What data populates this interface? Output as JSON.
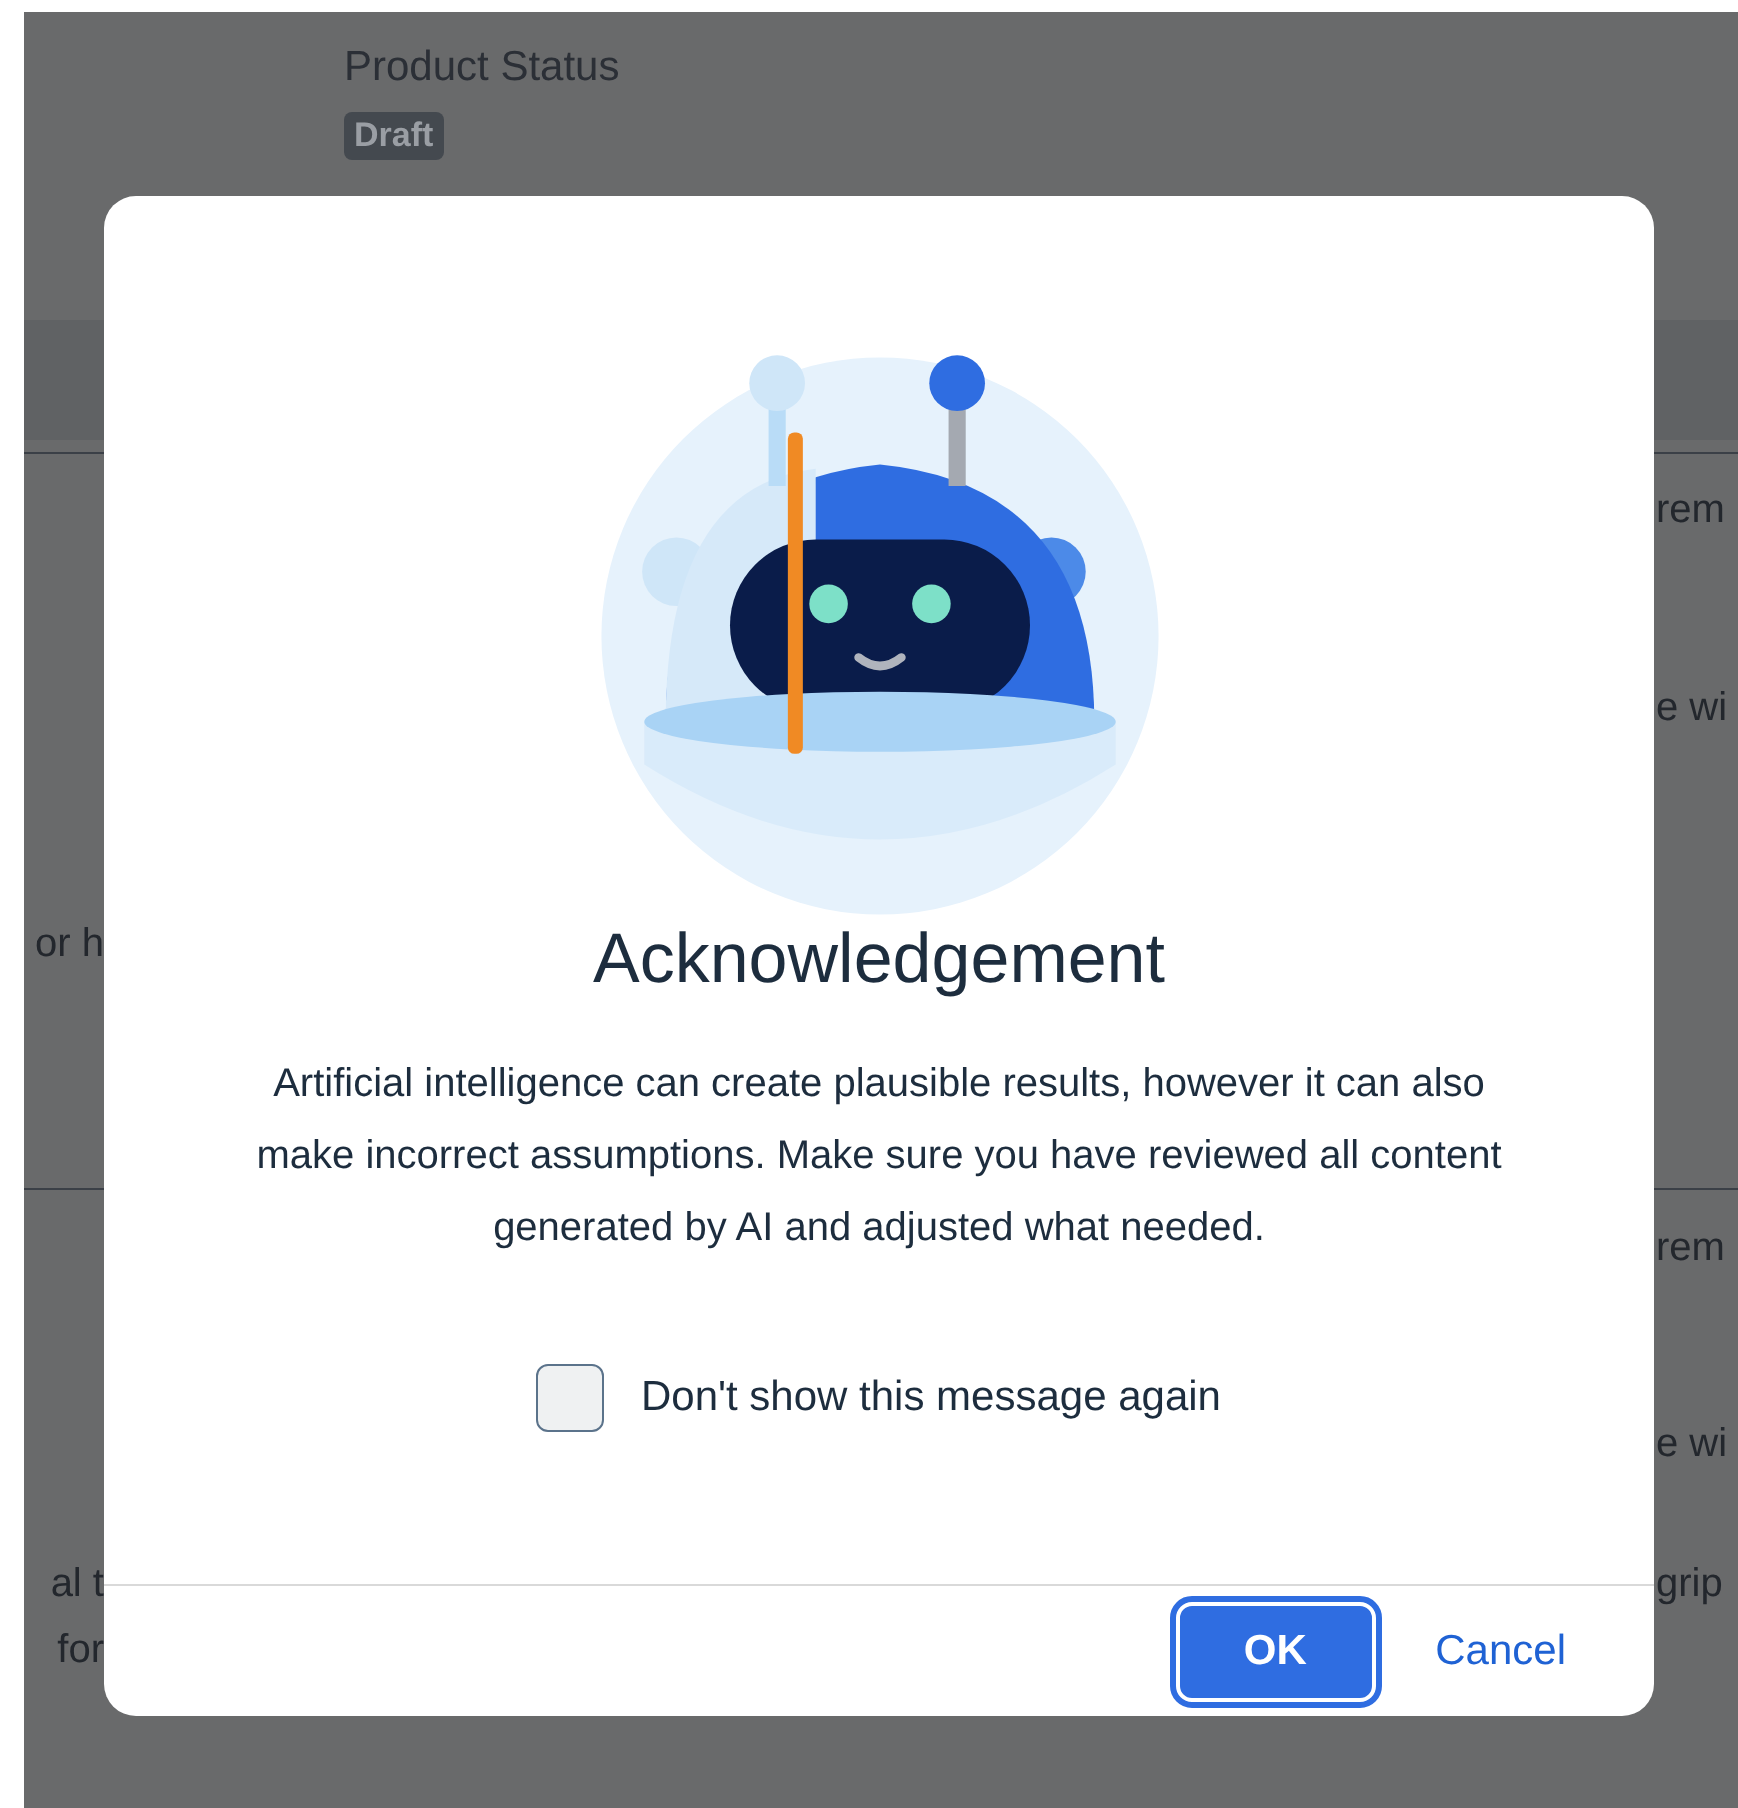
{
  "background": {
    "field_label": "Product Status",
    "status_badge": "Draft",
    "left_fragments": [
      "or h",
      "al t",
      "for"
    ],
    "right_fragments": [
      "rem",
      "e wi",
      "rem",
      "e wi",
      "grip"
    ]
  },
  "dialog": {
    "title": "Acknowledgement",
    "message": "Artificial intelligence can create plausible results, however it can also make incorrect assumptions. Make sure you have reviewed all content generated by AI and adjusted what needed.",
    "checkbox": {
      "label": "Don't show this message again",
      "checked": false
    },
    "buttons": [
      {
        "label": "OK",
        "kind": "primary",
        "focused": true
      },
      {
        "label": "Cancel",
        "kind": "transparent",
        "focused": false
      }
    ]
  }
}
